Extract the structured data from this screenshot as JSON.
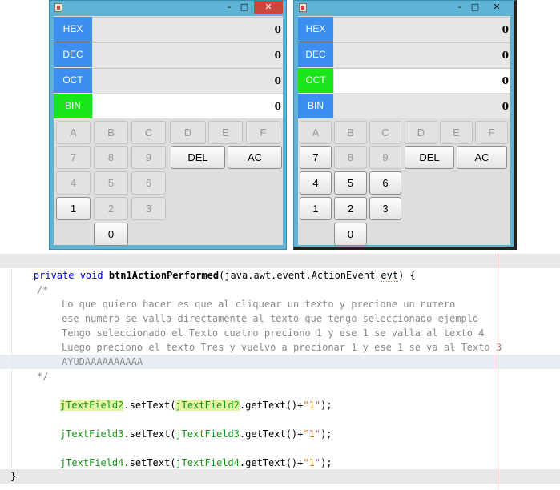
{
  "window1": {
    "controls": {
      "minimize": "–",
      "maximize": "□",
      "close": "✕"
    },
    "rows": [
      {
        "label": "HEX",
        "value": "0",
        "label_color": "#3d8fef",
        "active": false
      },
      {
        "label": "DEC",
        "value": "0",
        "label_color": "#3d8fef",
        "active": false
      },
      {
        "label": "OCT",
        "value": "0",
        "label_color": "#3d8fef",
        "active": false
      },
      {
        "label": "BIN",
        "value": "0",
        "label_color": "#19e619",
        "active": true
      }
    ],
    "keys": {
      "a": "A",
      "b": "B",
      "c": "C",
      "d": "D",
      "e": "E",
      "f": "F",
      "k7": "7",
      "k8": "8",
      "k9": "9",
      "del": "DEL",
      "ac": "AC",
      "k4": "4",
      "k5": "5",
      "k6": "6",
      "k1": "1",
      "k2": "2",
      "k3": "3",
      "k0": "0"
    }
  },
  "window2": {
    "controls": {
      "minimize": "–",
      "maximize": "□",
      "close": "✕"
    },
    "rows": [
      {
        "label": "HEX",
        "value": "0",
        "label_color": "#3d8fef",
        "active": false
      },
      {
        "label": "DEC",
        "value": "0",
        "label_color": "#3d8fef",
        "active": false
      },
      {
        "label": "OCT",
        "value": "0",
        "label_color": "#19e619",
        "active": true
      },
      {
        "label": "BIN",
        "value": "0",
        "label_color": "#3d8fef",
        "active": false
      }
    ],
    "keys": {
      "a": "A",
      "b": "B",
      "c": "C",
      "d": "D",
      "e": "E",
      "f": "F",
      "k7": "7",
      "k8": "8",
      "k9": "9",
      "del": "DEL",
      "ac": "AC",
      "k4": "4",
      "k5": "5",
      "k6": "6",
      "k1": "1",
      "k2": "2",
      "k3": "3",
      "k0": "0"
    }
  },
  "code": {
    "l1_kw": "private void ",
    "l1_name": "btn1ActionPerformed",
    "l1_args_a": "(java.awt.event.ActionEvent ",
    "l1_evt": "evt",
    "l1_end": ") {",
    "comment_open": "/*",
    "comment_1": "Lo que quiero hacer es que al cliquear un texto y precione un numero",
    "comment_2": "ese numero se valla directamente al texto que tengo seleccionado ejemplo",
    "comment_3": "Tengo seleccionado el Texto cuatro preciono 1 y ese 1 se valla al texto 4",
    "comment_4": "Luego preciono el texto Tres y vuelvo a precionar 1 y ese 1 se va al Texto 3",
    "comment_5": "AYUDAAAAAAAAAA",
    "comment_close": "*/",
    "s1_field": "jTextField2",
    "s1_mid": ".setText(",
    "s1_field2": "jTextField2",
    "s1_get": ".getText()+",
    "s1_str": "\"1\"",
    "s1_end": ");",
    "s2_field": "jTextField3",
    "s2_mid": ".setText(",
    "s2_field2": "jTextField3",
    "s2_get": ".getText()+",
    "s2_str": "\"1\"",
    "s2_end": ");",
    "s3_field": "jTextField4",
    "s3_mid": ".setText(",
    "s3_field2": "jTextField4",
    "s3_get": ".getText()+",
    "s3_str": "\"1\"",
    "s3_end": ");",
    "close_brace": "}"
  },
  "colors": {
    "window_frame": "#5fb4d6",
    "close_button": "#c9463b",
    "selected_label": "#19e619",
    "label_blue": "#3d8fef"
  }
}
